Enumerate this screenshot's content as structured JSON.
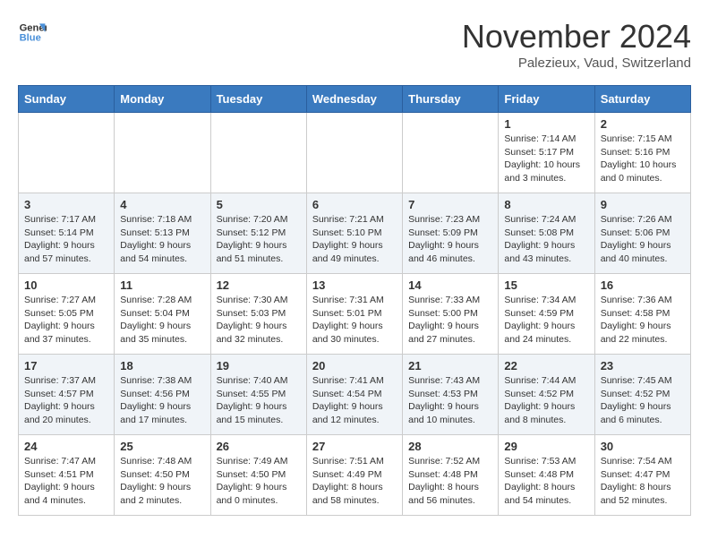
{
  "logo": {
    "line1": "General",
    "line2": "Blue"
  },
  "title": "November 2024",
  "location": "Palezieux, Vaud, Switzerland",
  "days_of_week": [
    "Sunday",
    "Monday",
    "Tuesday",
    "Wednesday",
    "Thursday",
    "Friday",
    "Saturday"
  ],
  "weeks": [
    [
      {
        "day": "",
        "info": ""
      },
      {
        "day": "",
        "info": ""
      },
      {
        "day": "",
        "info": ""
      },
      {
        "day": "",
        "info": ""
      },
      {
        "day": "",
        "info": ""
      },
      {
        "day": "1",
        "info": "Sunrise: 7:14 AM\nSunset: 5:17 PM\nDaylight: 10 hours and 3 minutes."
      },
      {
        "day": "2",
        "info": "Sunrise: 7:15 AM\nSunset: 5:16 PM\nDaylight: 10 hours and 0 minutes."
      }
    ],
    [
      {
        "day": "3",
        "info": "Sunrise: 7:17 AM\nSunset: 5:14 PM\nDaylight: 9 hours and 57 minutes."
      },
      {
        "day": "4",
        "info": "Sunrise: 7:18 AM\nSunset: 5:13 PM\nDaylight: 9 hours and 54 minutes."
      },
      {
        "day": "5",
        "info": "Sunrise: 7:20 AM\nSunset: 5:12 PM\nDaylight: 9 hours and 51 minutes."
      },
      {
        "day": "6",
        "info": "Sunrise: 7:21 AM\nSunset: 5:10 PM\nDaylight: 9 hours and 49 minutes."
      },
      {
        "day": "7",
        "info": "Sunrise: 7:23 AM\nSunset: 5:09 PM\nDaylight: 9 hours and 46 minutes."
      },
      {
        "day": "8",
        "info": "Sunrise: 7:24 AM\nSunset: 5:08 PM\nDaylight: 9 hours and 43 minutes."
      },
      {
        "day": "9",
        "info": "Sunrise: 7:26 AM\nSunset: 5:06 PM\nDaylight: 9 hours and 40 minutes."
      }
    ],
    [
      {
        "day": "10",
        "info": "Sunrise: 7:27 AM\nSunset: 5:05 PM\nDaylight: 9 hours and 37 minutes."
      },
      {
        "day": "11",
        "info": "Sunrise: 7:28 AM\nSunset: 5:04 PM\nDaylight: 9 hours and 35 minutes."
      },
      {
        "day": "12",
        "info": "Sunrise: 7:30 AM\nSunset: 5:03 PM\nDaylight: 9 hours and 32 minutes."
      },
      {
        "day": "13",
        "info": "Sunrise: 7:31 AM\nSunset: 5:01 PM\nDaylight: 9 hours and 30 minutes."
      },
      {
        "day": "14",
        "info": "Sunrise: 7:33 AM\nSunset: 5:00 PM\nDaylight: 9 hours and 27 minutes."
      },
      {
        "day": "15",
        "info": "Sunrise: 7:34 AM\nSunset: 4:59 PM\nDaylight: 9 hours and 24 minutes."
      },
      {
        "day": "16",
        "info": "Sunrise: 7:36 AM\nSunset: 4:58 PM\nDaylight: 9 hours and 22 minutes."
      }
    ],
    [
      {
        "day": "17",
        "info": "Sunrise: 7:37 AM\nSunset: 4:57 PM\nDaylight: 9 hours and 20 minutes."
      },
      {
        "day": "18",
        "info": "Sunrise: 7:38 AM\nSunset: 4:56 PM\nDaylight: 9 hours and 17 minutes."
      },
      {
        "day": "19",
        "info": "Sunrise: 7:40 AM\nSunset: 4:55 PM\nDaylight: 9 hours and 15 minutes."
      },
      {
        "day": "20",
        "info": "Sunrise: 7:41 AM\nSunset: 4:54 PM\nDaylight: 9 hours and 12 minutes."
      },
      {
        "day": "21",
        "info": "Sunrise: 7:43 AM\nSunset: 4:53 PM\nDaylight: 9 hours and 10 minutes."
      },
      {
        "day": "22",
        "info": "Sunrise: 7:44 AM\nSunset: 4:52 PM\nDaylight: 9 hours and 8 minutes."
      },
      {
        "day": "23",
        "info": "Sunrise: 7:45 AM\nSunset: 4:52 PM\nDaylight: 9 hours and 6 minutes."
      }
    ],
    [
      {
        "day": "24",
        "info": "Sunrise: 7:47 AM\nSunset: 4:51 PM\nDaylight: 9 hours and 4 minutes."
      },
      {
        "day": "25",
        "info": "Sunrise: 7:48 AM\nSunset: 4:50 PM\nDaylight: 9 hours and 2 minutes."
      },
      {
        "day": "26",
        "info": "Sunrise: 7:49 AM\nSunset: 4:50 PM\nDaylight: 9 hours and 0 minutes."
      },
      {
        "day": "27",
        "info": "Sunrise: 7:51 AM\nSunset: 4:49 PM\nDaylight: 8 hours and 58 minutes."
      },
      {
        "day": "28",
        "info": "Sunrise: 7:52 AM\nSunset: 4:48 PM\nDaylight: 8 hours and 56 minutes."
      },
      {
        "day": "29",
        "info": "Sunrise: 7:53 AM\nSunset: 4:48 PM\nDaylight: 8 hours and 54 minutes."
      },
      {
        "day": "30",
        "info": "Sunrise: 7:54 AM\nSunset: 4:47 PM\nDaylight: 8 hours and 52 minutes."
      }
    ]
  ]
}
